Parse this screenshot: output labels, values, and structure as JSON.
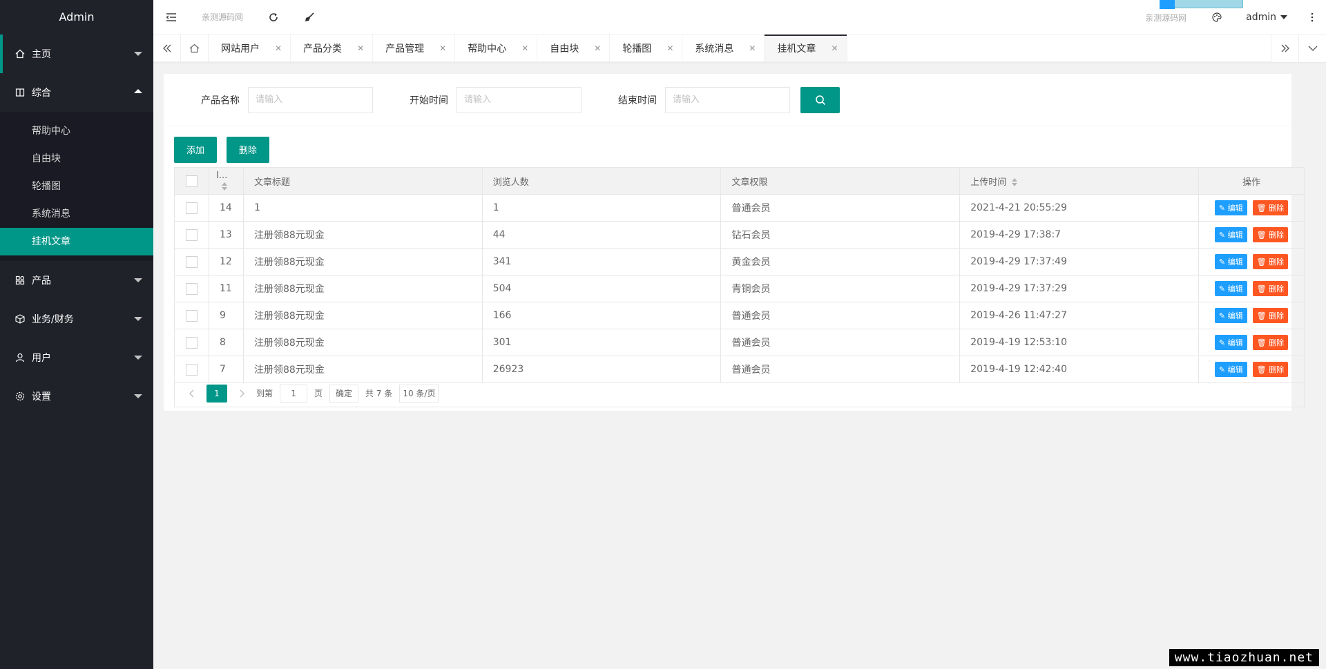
{
  "sidebar": {
    "logo": "Admin",
    "home": "主页",
    "general": "综合",
    "sub": [
      "帮助中心",
      "自由块",
      "轮播图",
      "系统消息",
      "挂机文章"
    ],
    "product": "产品",
    "business": "业务/财务",
    "user": "用户",
    "settings": "设置"
  },
  "header": {
    "site_left": "亲测源码网",
    "site_right": "亲测源码网",
    "username": "admin"
  },
  "tabs": [
    "网站用户",
    "产品分类",
    "产品管理",
    "帮助中心",
    "自由块",
    "轮播图",
    "系统消息",
    "挂机文章"
  ],
  "search": {
    "name_label": "产品名称",
    "start_label": "开始时间",
    "end_label": "结束时间",
    "placeholder": "请输入"
  },
  "toolbar": {
    "add": "添加",
    "delete": "删除"
  },
  "table": {
    "headers": {
      "id": "I...",
      "title": "文章标题",
      "views": "浏览人数",
      "perm": "文章权限",
      "time": "上传时间",
      "op": "操作"
    },
    "edit_label": "编辑",
    "del_label": "删除",
    "rows": [
      {
        "id": "14",
        "title": "1",
        "views": "1",
        "perm": "普通会员",
        "time": "2021-4-21 20:55:29"
      },
      {
        "id": "13",
        "title": "注册领88元现金",
        "views": "44",
        "perm": "钻石会员",
        "time": "2019-4-29 17:38:7"
      },
      {
        "id": "12",
        "title": "注册领88元现金",
        "views": "341",
        "perm": "黄金会员",
        "time": "2019-4-29 17:37:49"
      },
      {
        "id": "11",
        "title": "注册领88元现金",
        "views": "504",
        "perm": "青铜会员",
        "time": "2019-4-29 17:37:29"
      },
      {
        "id": "9",
        "title": "注册领88元现金",
        "views": "166",
        "perm": "普通会员",
        "time": "2019-4-26 11:47:27"
      },
      {
        "id": "8",
        "title": "注册领88元现金",
        "views": "301",
        "perm": "普通会员",
        "time": "2019-4-19 12:53:10"
      },
      {
        "id": "7",
        "title": "注册领88元现金",
        "views": "26923",
        "perm": "普通会员",
        "time": "2019-4-19 12:42:40"
      }
    ]
  },
  "pager": {
    "current": "1",
    "goto": "到第",
    "page_value": "1",
    "page_unit": "页",
    "confirm": "确定",
    "total": "共 7 条",
    "per_page": "10 条/页"
  },
  "watermark": "www.tiaozhuan.net",
  "colors": {
    "primary": "#009688",
    "sidebar": "#20222a",
    "edit": "#1e9fff",
    "delete": "#ff5722"
  }
}
